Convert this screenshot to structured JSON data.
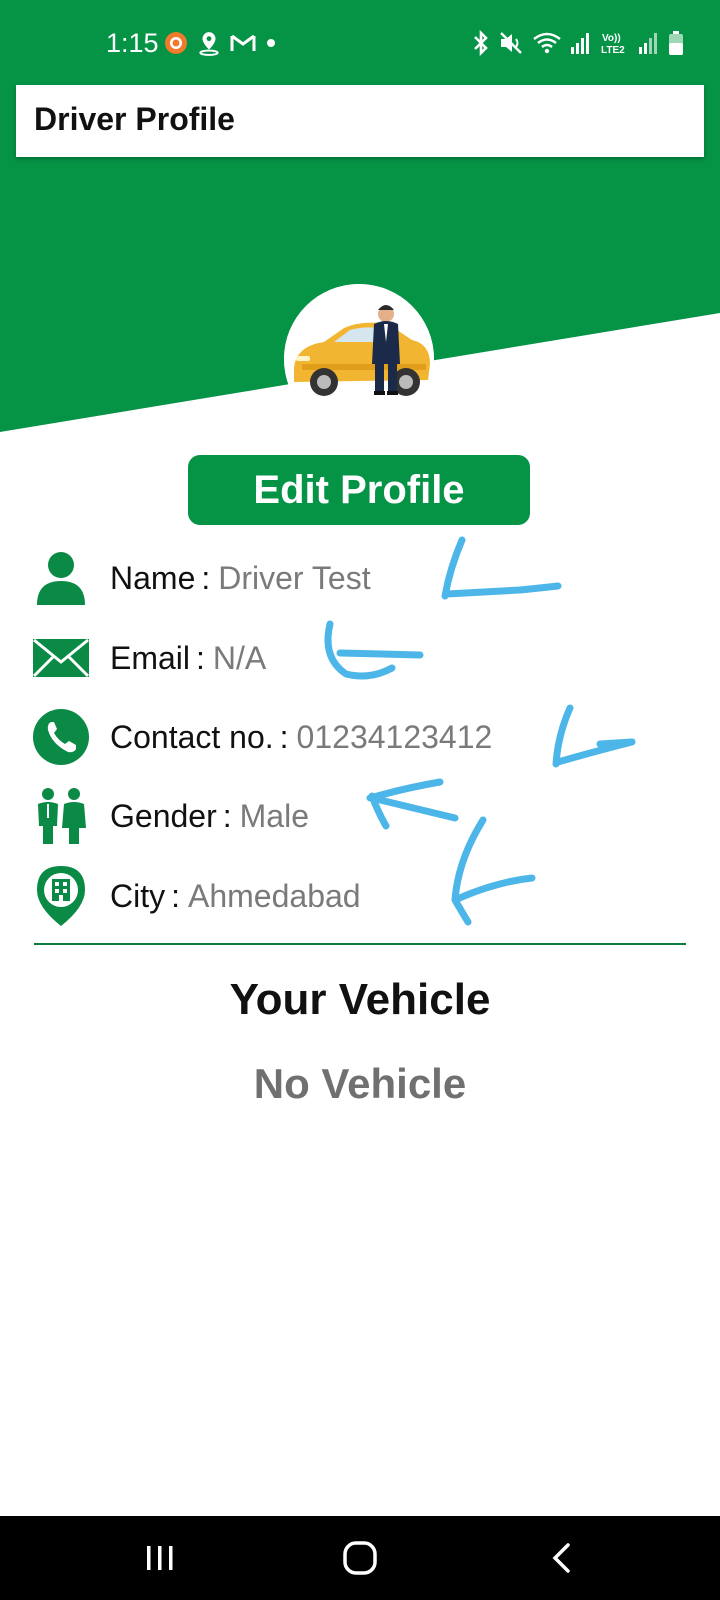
{
  "status_bar": {
    "time": "1:15",
    "left_icons": [
      "screen-recorder-icon",
      "location-pin-icon",
      "gmail-icon",
      "notification-dot-icon"
    ],
    "right_icons": [
      "bluetooth-icon",
      "mute-icon",
      "wifi-icon",
      "signal-icon",
      "volte-lte2-icon",
      "signal-icon",
      "battery-icon"
    ],
    "volte_label": "Vo)) LTE2"
  },
  "app_bar": {
    "title": "Driver Profile"
  },
  "colors": {
    "brand_green": "#059346",
    "annotation_blue": "#4DB6E8"
  },
  "profile": {
    "avatar_icon": "taxi-driver-avatar-icon",
    "edit_label": "Edit Profile"
  },
  "details": [
    {
      "icon": "person-icon",
      "label": "Name",
      "sep": ":",
      "value": "Driver Test"
    },
    {
      "icon": "email-icon",
      "label": "Email",
      "sep": ":",
      "value": "N/A"
    },
    {
      "icon": "phone-icon",
      "label": "Contact no.",
      "sep": ":",
      "value": "01234123412"
    },
    {
      "icon": "gender-icon",
      "label": "Gender",
      "sep": ":",
      "value": "Male"
    },
    {
      "icon": "city-pin-icon",
      "label": "City",
      "sep": ":",
      "value": "Ahmedabad"
    }
  ],
  "vehicle": {
    "title": "Your Vehicle",
    "empty_text": "No Vehicle"
  },
  "nav_bar": {
    "icons": [
      "recent-apps-icon",
      "home-icon",
      "back-icon"
    ]
  }
}
